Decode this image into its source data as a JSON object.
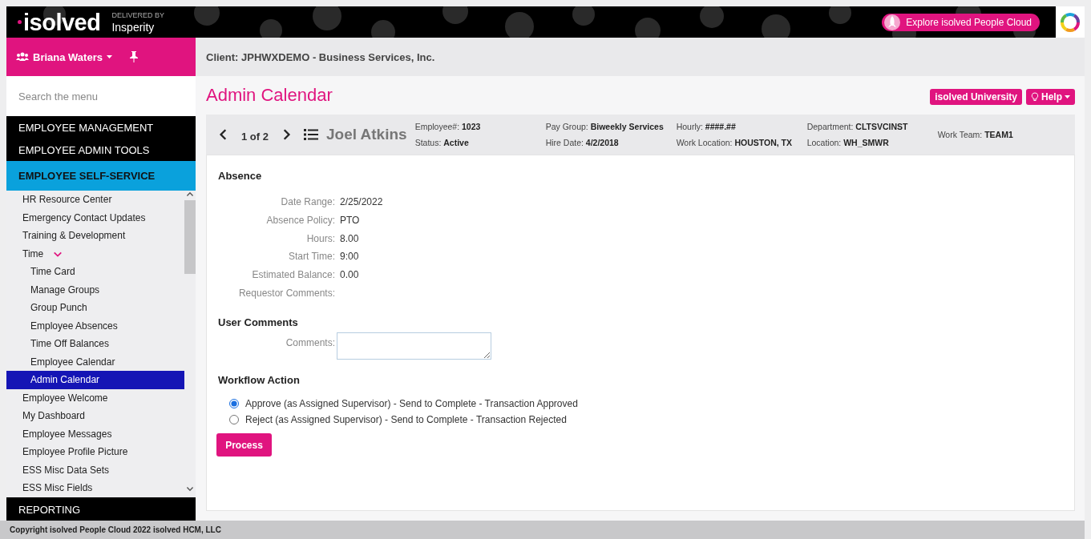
{
  "header": {
    "logo": "isolved",
    "tagline": "DELIVERED BY",
    "partner": "Insperity",
    "explore_button": "Explore isolved People Cloud"
  },
  "user_menu": {
    "name": "Briana Waters"
  },
  "client": "Client: JPHWXDEMO - Business Services, Inc.",
  "search": {
    "placeholder": "Search the menu"
  },
  "menu": [
    {
      "label": "EMPLOYEE MANAGEMENT",
      "expanded": false
    },
    {
      "label": "EMPLOYEE ADMIN TOOLS",
      "expanded": false
    },
    {
      "label": "EMPLOYEE SELF-SERVICE",
      "expanded": true,
      "items": [
        {
          "label": "HR Resource Center",
          "selected": false
        },
        {
          "label": "Emergency Contact Updates",
          "selected": false
        },
        {
          "label": "Training & Development",
          "selected": false
        },
        {
          "label": "Time",
          "selected": false,
          "expanded": true,
          "children": [
            {
              "label": "Time Card",
              "selected": false
            },
            {
              "label": "Manage Groups",
              "selected": false
            },
            {
              "label": "Group Punch",
              "selected": false
            },
            {
              "label": "Employee Absences",
              "selected": false
            },
            {
              "label": "Time Off Balances",
              "selected": false
            },
            {
              "label": "Employee Calendar",
              "selected": false
            },
            {
              "label": "Admin Calendar",
              "selected": true
            }
          ]
        },
        {
          "label": "Employee Welcome",
          "selected": false
        },
        {
          "label": "My Dashboard",
          "selected": false
        },
        {
          "label": "Employee Messages",
          "selected": false
        },
        {
          "label": "Employee Profile Picture",
          "selected": false
        },
        {
          "label": "ESS Misc Data Sets",
          "selected": false
        },
        {
          "label": "ESS Misc Fields",
          "selected": false
        }
      ]
    },
    {
      "label": "REPORTING",
      "expanded": false
    }
  ],
  "page_title": "Admin Calendar",
  "top_buttons": [
    {
      "label": "isolved University",
      "kind": "plain"
    },
    {
      "label": "Help",
      "kind": "help"
    }
  ],
  "employee": {
    "pager": "1 of 2",
    "name": "Joel Atkins",
    "columns": [
      {
        "lines": [
          "Employee#: **1023**",
          "Status: **Active**"
        ]
      },
      {
        "lines": [
          "Pay Group: **Biweekly Services**",
          "Hire Date: **4/2/2018**"
        ]
      },
      {
        "lines": [
          "Hourly: **####.##**",
          "Work Location: **HOUSTON, TX**"
        ]
      },
      {
        "lines": [
          "Department: **CLTSVCINST**",
          "Location: **WH_SMWR**"
        ]
      },
      {
        "lines": [
          "Work Team: **TEAM1**"
        ]
      }
    ]
  },
  "absence": {
    "title": "Absence",
    "rows": [
      {
        "label": "Date Range:",
        "value": "2/25/2022"
      },
      {
        "label": "Absence Policy:",
        "value": "PTO"
      },
      {
        "label": "Hours:",
        "value": "8.00"
      },
      {
        "label": "Start Time:",
        "value": "9:00"
      },
      {
        "label": "Estimated Balance:",
        "value": "0.00"
      },
      {
        "label": "Requestor Comments:"
      }
    ]
  },
  "user_comments": {
    "title": "User Comments",
    "label": "Comments:"
  },
  "workflow": {
    "title": "Workflow Action",
    "options": [
      {
        "label": "Approve (as Assigned Supervisor) - Send to Complete - Transaction Approved",
        "selected": true
      },
      {
        "label": "Reject (as Assigned Supervisor) - Send to Complete - Transaction Rejected",
        "selected": false
      }
    ],
    "button": "Process"
  },
  "footer": "Copyright isolved People Cloud 2022 isolved HCM, LLC"
}
